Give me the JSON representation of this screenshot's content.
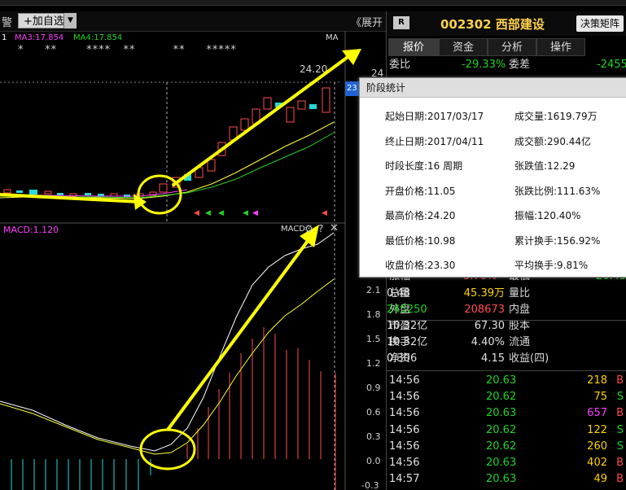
{
  "toolbar": {
    "left_stub": "警",
    "add_button": "+加自选",
    "collapse_label": "《展开"
  },
  "indicators": {
    "ma3": "MA3:17.854",
    "ma4": "MA4:17.854",
    "ma_short": "MA",
    "ma_prefix": "1",
    "macd": "MACD:1.120",
    "macd_panel": "MACD"
  },
  "price_labels": {
    "peak": "24.20",
    "right_top": "24",
    "right_box": "23"
  },
  "stock": {
    "badge": "R",
    "title": "002302 西部建设",
    "decide_button": "决策矩阵"
  },
  "tabs": [
    "报价",
    "资金",
    "分析",
    "操作"
  ],
  "quote_top": {
    "weibi_label": "委比",
    "weibi_value": "-29.33%",
    "weicha_label": "委差",
    "weicha_value": "-2455"
  },
  "popup": {
    "title": "阶段统计",
    "rows": [
      {
        "l": "起始日期:2017/03/17",
        "r": "成交量:1619.79万"
      },
      {
        "l": "终止日期:2017/04/11",
        "r": "成交额:290.44亿"
      },
      {
        "l": "时段长度:16 周期",
        "r": "张跌值:12.29"
      },
      {
        "l": "开盘价格:11.05",
        "r": "张跌比例:111.63%"
      },
      {
        "l": "最高价格:24.20",
        "r": "振幅:120.40%"
      },
      {
        "l": "最低价格:10.98",
        "r": "累计换手:156.92%"
      },
      {
        "l": "收盘价格:23.30",
        "r": "平均换手:9.81%"
      }
    ]
  },
  "macd_axis": [
    "2.1",
    "1.8",
    "1.5",
    "1.2",
    "0.9",
    "0.6",
    "0.3",
    "0.0",
    "-0.3"
  ],
  "stats": {
    "partial_top": {
      "l": "涨幅",
      "v": "3.76%",
      "l2": "最低",
      "v2": "20.43"
    },
    "rows": [
      {
        "l": "总量",
        "v": "45.39万",
        "vc": "yellow",
        "l2": "量比",
        "v2": "0.48",
        "v2c": "white"
      },
      {
        "l": "外盘",
        "v": "208673",
        "vc": "red",
        "l2": "内盘",
        "v2": "245250",
        "v2c": "green"
      },
      {
        "l": "市盈",
        "v": "67.30",
        "vc": "white",
        "l2": "股本",
        "v2": "10.32亿",
        "v2c": "white"
      },
      {
        "l": "换手",
        "v": "4.40%",
        "vc": "white",
        "l2": "流通",
        "v2": "10.32亿",
        "v2c": "white"
      },
      {
        "l": "净资",
        "v": "4.15",
        "vc": "white",
        "l2": "收益(四)",
        "v2": "0.306",
        "v2c": "white"
      }
    ]
  },
  "ticks": [
    {
      "t": "14:56",
      "p": "20.63",
      "v": "218",
      "vc": "yellow",
      "s": "B"
    },
    {
      "t": "14:56",
      "p": "20.62",
      "v": "75",
      "vc": "yellow",
      "s": "S"
    },
    {
      "t": "14:56",
      "p": "20.63",
      "v": "657",
      "vc": "magenta",
      "s": "B"
    },
    {
      "t": "14:56",
      "p": "20.62",
      "v": "122",
      "vc": "yellow",
      "s": "S"
    },
    {
      "t": "14:56",
      "p": "20.62",
      "v": "260",
      "vc": "yellow",
      "s": "S"
    },
    {
      "t": "14:56",
      "p": "20.63",
      "v": "402",
      "vc": "yellow",
      "s": "B"
    },
    {
      "t": "14:57",
      "p": "20.63",
      "v": "49",
      "vc": "yellow",
      "s": "B"
    }
  ]
}
